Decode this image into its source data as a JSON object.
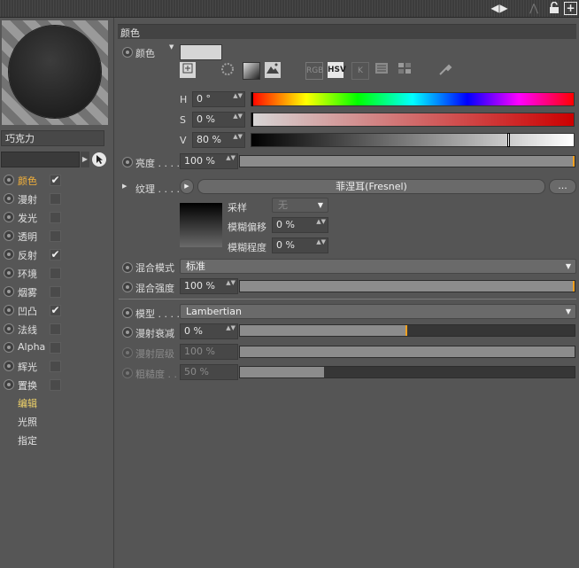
{
  "topbar": {
    "nav_left": "◀",
    "nav_right": "▶",
    "up": "⋀",
    "lock": "🔓",
    "add": "+"
  },
  "material": {
    "name": "巧克力"
  },
  "channels": [
    {
      "label": "颜色",
      "checked": true,
      "active": true
    },
    {
      "label": "漫射",
      "checked": false,
      "active": false
    },
    {
      "label": "发光",
      "checked": false,
      "active": false
    },
    {
      "label": "透明",
      "checked": false,
      "active": false
    },
    {
      "label": "反射",
      "checked": true,
      "active": false
    },
    {
      "label": "环境",
      "checked": false,
      "active": false
    },
    {
      "label": "烟雾",
      "checked": false,
      "active": false
    },
    {
      "label": "凹凸",
      "checked": true,
      "active": false
    },
    {
      "label": "法线",
      "checked": false,
      "active": false
    },
    {
      "label": "Alpha",
      "checked": false,
      "active": false
    },
    {
      "label": "辉光",
      "checked": false,
      "active": false
    },
    {
      "label": "置换",
      "checked": false,
      "active": false
    }
  ],
  "subitems": [
    {
      "label": "编辑",
      "active": true
    },
    {
      "label": "光照",
      "active": false
    },
    {
      "label": "指定",
      "active": false
    }
  ],
  "check_glyph": "✔",
  "section": {
    "title": "颜色"
  },
  "color": {
    "label": "颜色",
    "swatch": "#d6d6d6",
    "tool_labels": {
      "rgb": "RGB",
      "hsv": "HSV",
      "k": "K"
    },
    "h": {
      "label": "H",
      "value": "0 °"
    },
    "s": {
      "label": "S",
      "value": "0 %"
    },
    "v": {
      "label": "V",
      "value": "80 %",
      "level": 0.8
    }
  },
  "brightness": {
    "label": "亮度 . . . .",
    "value": "100 %",
    "level": 1.0
  },
  "texture": {
    "label": "纹理 . . . .",
    "shader": "菲涅耳(Fresnel)",
    "more": "...",
    "sampling_label": "采样",
    "sampling_value": "无",
    "blur_offset_label": "模糊偏移",
    "blur_offset_value": "0 %",
    "blur_amount_label": "模糊程度",
    "blur_amount_value": "0 %"
  },
  "mix_mode": {
    "label": "混合模式",
    "value": "标准"
  },
  "mix_strength": {
    "label": "混合强度",
    "value": "100 %",
    "level": 1.0
  },
  "model": {
    "label": "模型 . . . .",
    "value": "Lambertian"
  },
  "diffuse_falloff": {
    "label": "漫射衰减",
    "value": "0 %",
    "level": 0.5
  },
  "diffuse_level": {
    "label": "漫射层级",
    "value": "100 %",
    "level": 1.0
  },
  "roughness": {
    "label": "粗糙度 . . .",
    "value": "50 %",
    "level": 0.25
  },
  "spinner_glyph": "▲▼",
  "caret_glyph": "▼",
  "arrow_glyph": "▶"
}
